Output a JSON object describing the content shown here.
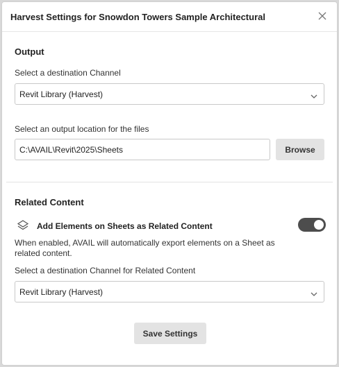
{
  "dialog": {
    "title": "Harvest Settings for Snowdon Towers Sample Architectural"
  },
  "output": {
    "heading": "Output",
    "channel_label": "Select a destination Channel",
    "channel_value": "Revit Library (Harvest)",
    "location_label": "Select an output location for the files",
    "location_value": "C:\\AVAIL\\Revit\\2025\\Sheets",
    "browse_label": "Browse"
  },
  "related": {
    "heading": "Related Content",
    "toggle_label": "Add Elements on Sheets as Related Content",
    "toggle_on": true,
    "description": "When enabled, AVAIL will automatically export elements on a Sheet as related content.",
    "channel_label": "Select a destination Channel for Related Content",
    "channel_value": "Revit Library (Harvest)"
  },
  "footer": {
    "save_label": "Save Settings"
  },
  "icons": {
    "close": "close-icon",
    "chevron": "chevron-down-icon",
    "layers": "layers-icon"
  },
  "colors": {
    "toggle_on": "#4d4d4d",
    "button_bg": "#e3e3e3"
  }
}
